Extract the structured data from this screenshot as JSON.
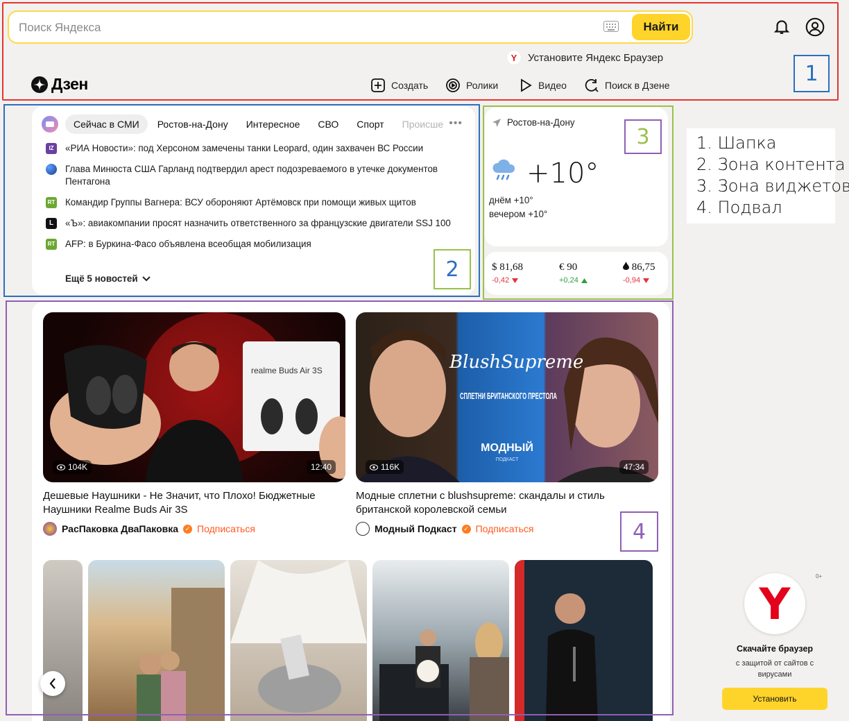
{
  "header": {
    "search_placeholder": "Поиск Яндекса",
    "search_button": "Найти",
    "promo_icon": "Y",
    "promo_text": "Установите Яндекс Браузер",
    "logo_text": "Дзен",
    "nav": [
      {
        "label": "Создать",
        "icon": "plus-square-icon"
      },
      {
        "label": "Ролики",
        "icon": "clips-icon"
      },
      {
        "label": "Видео",
        "icon": "play-icon"
      },
      {
        "label": "Поиск в Дзене",
        "icon": "search-refresh-icon"
      }
    ]
  },
  "annotations": {
    "n1": "1",
    "n2": "2",
    "n3": "3",
    "n4": "4"
  },
  "legend": [
    "1. Шапка",
    "2. Зона контента",
    "3. Зона виджетов",
    "4. Подвал"
  ],
  "news": {
    "tabs": [
      "Сейчас в СМИ",
      "Ростов-на-Дону",
      "Интересное",
      "СВО",
      "Спорт",
      "Происше"
    ],
    "active_tab": "Сейчас в СМИ",
    "items": [
      {
        "source_mark": "IZ",
        "source_color": "#6b3fa0",
        "text": "«РИА Новости»: под Херсоном замечены танки Leopard, один захвачен ВС России"
      },
      {
        "source_mark": "",
        "source_color": "#2a5fb8",
        "text": "Глава Минюста США Гарланд подтвердил арест подозреваемого в утечке документов Пентагона"
      },
      {
        "source_mark": "RT",
        "source_color": "#6aa833",
        "text": "Командир Группы Вагнера: ВСУ обороняют Артёмовск при помощи живых щитов"
      },
      {
        "source_mark": "L",
        "source_color": "#111111",
        "text": "«Ъ»: авиакомпании просят назначить ответственного за французские двигатели SSJ 100"
      },
      {
        "source_mark": "RT",
        "source_color": "#6aa833",
        "text": "AFP: в Буркина-Фасо объявлена всеобщая мобилизация"
      }
    ],
    "more": "Ещё 5 новостей"
  },
  "weather": {
    "city": "Ростов-на-Дону",
    "temp": "+10°",
    "day": "днём +10°",
    "evening": "вечером +10°"
  },
  "rates": [
    {
      "value": "$ 81,68",
      "delta": "-0,42",
      "dir": "down"
    },
    {
      "value": "€ 90",
      "delta": "+0,24",
      "dir": "up"
    },
    {
      "value": "86,75",
      "delta": "-0,94",
      "dir": "down"
    }
  ],
  "videos": [
    {
      "views": "104K",
      "duration": "12:40",
      "title": "Дешевые Наушники - Не Значит, что Плохо! Бюджетные Наушники Realme Buds Air 3S",
      "channel": "РасПаковка ДваПаковка",
      "subscribe": "Подписаться",
      "box_label": "realme Buds Air 3S"
    },
    {
      "views": "116K",
      "duration": "47:34",
      "title": "Модные сплетни с blushsupreme: скандалы и стиль британской королевской семьи",
      "channel": "Модный Подкаст",
      "subscribe": "Подписаться",
      "overlay_script": "BlushSupreme",
      "overlay_title": "СПЛЕТНИ БРИТАНСКОГО ПРЕСТОЛА",
      "overlay_brand": "МОДНЫЙ",
      "overlay_brand_sub": "ПОДКАСТ"
    }
  ],
  "browser_promo": {
    "age": "0+",
    "title": "Скачайте браузер",
    "subtitle": "с защитой от сайтов с вирусами",
    "button": "Установить"
  }
}
